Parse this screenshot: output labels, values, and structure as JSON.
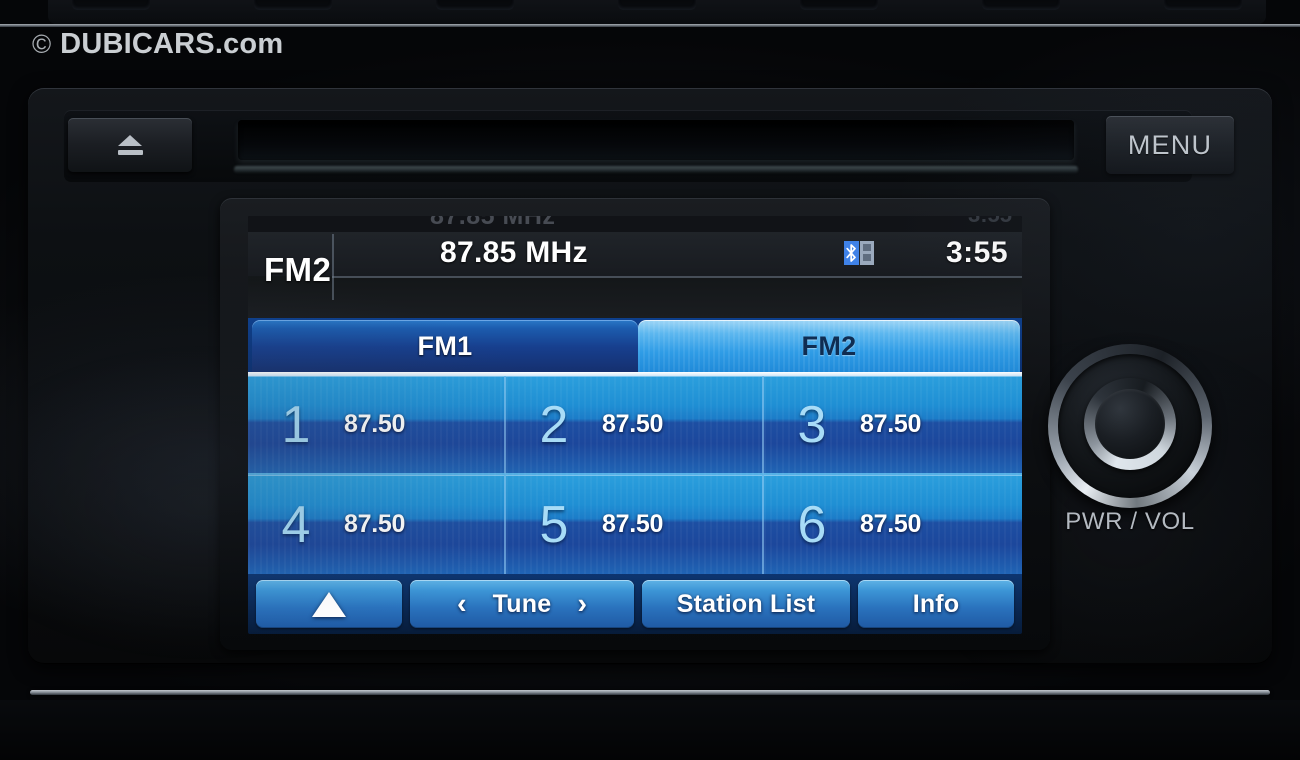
{
  "watermark": {
    "symbol": "©",
    "text": "DUBICARS.com"
  },
  "faceplate": {
    "eject_icon": "eject-icon",
    "cd_slot": "cd-slot",
    "menu_label": "MENU",
    "knob_label": "PWR / VOL"
  },
  "screen": {
    "status": {
      "band": "FM2",
      "frequency": "87.85 MHz",
      "bluetooth_icon": "bluetooth-icon",
      "clock": "3:55",
      "ghost_frequency": "87.85 MHz",
      "ghost_clock": "3:55"
    },
    "tabs": [
      {
        "label": "FM1",
        "active": false
      },
      {
        "label": "FM2",
        "active": true
      }
    ],
    "presets": [
      {
        "number": "1",
        "frequency": "87.50"
      },
      {
        "number": "2",
        "frequency": "87.50"
      },
      {
        "number": "3",
        "frequency": "87.50"
      },
      {
        "number": "4",
        "frequency": "87.50"
      },
      {
        "number": "5",
        "frequency": "87.50"
      },
      {
        "number": "6",
        "frequency": "87.50"
      }
    ],
    "softkeys": {
      "up": "up-arrow-icon",
      "tune_prev": "‹",
      "tune_label": "Tune",
      "tune_next": "›",
      "station_list": "Station List",
      "info": "Info"
    }
  },
  "colors": {
    "accent_blue": "#1f8ad9",
    "tab_active": "#5cb7ef",
    "tab_inactive": "#173f8e",
    "preset_number": "#a8dcf7",
    "bluetooth": "#3f82e8",
    "text_white": "#ffffff"
  }
}
